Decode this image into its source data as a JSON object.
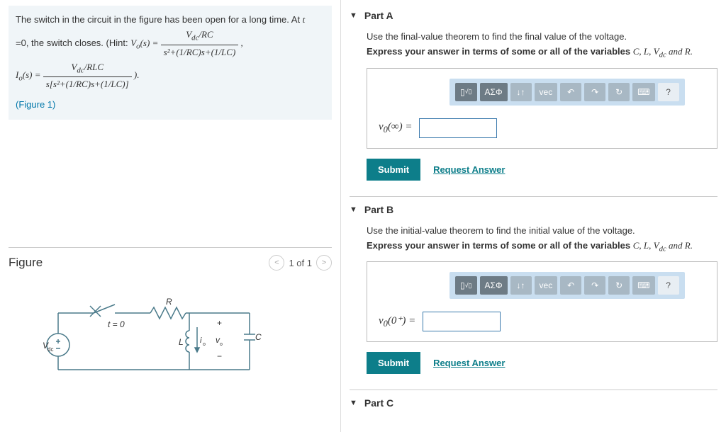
{
  "problem": {
    "text1": "The switch in the circuit in the figure has been open for a long time. At ",
    "tvar": "t",
    "text2": " =0, the switch closes. (Hint: ",
    "hint_vo": "V_o(s) = (V_dc/RC) / (s²+(1/RC)s+(1/LC)) ,",
    "hint_io": "I_o(s) = (V_dc/RLC) / (s[s²+(1/RC)s+(1/LC)]) ).",
    "figure_link": "(Figure 1)"
  },
  "figure": {
    "title": "Figure",
    "nav": "1 of 1",
    "labels": {
      "vdc": "V_dc",
      "t0": "t = 0",
      "R": "R",
      "L": "L",
      "io": "i_o",
      "vo": "v_o",
      "C": "C",
      "plus": "+",
      "minus": "−"
    }
  },
  "partA": {
    "header": "Part A",
    "instruction": "Use the final-value theorem to find the final value of the voltage.",
    "express": "Express your answer in terms of some or all of the variables ",
    "vars": "C, L, V_dc and R.",
    "label": "v_0(∞) = ",
    "submit": "Submit",
    "request": "Request Answer"
  },
  "partB": {
    "header": "Part B",
    "instruction": "Use the initial-value theorem to find the initial value of the voltage.",
    "express": "Express your answer in terms of some or all of the variables ",
    "vars": "C, L, V_dc and R.",
    "label": "v_0(0⁺) = ",
    "submit": "Submit",
    "request": "Request Answer"
  },
  "partC": {
    "header": "Part C"
  },
  "toolbar": {
    "templates": "▢√▢",
    "greek": "ΑΣΦ",
    "updown": "↓↑",
    "vec": "vec",
    "undo": "↶",
    "redo": "↷",
    "reset": "↻",
    "keyboard": "⌨",
    "help": "?"
  }
}
